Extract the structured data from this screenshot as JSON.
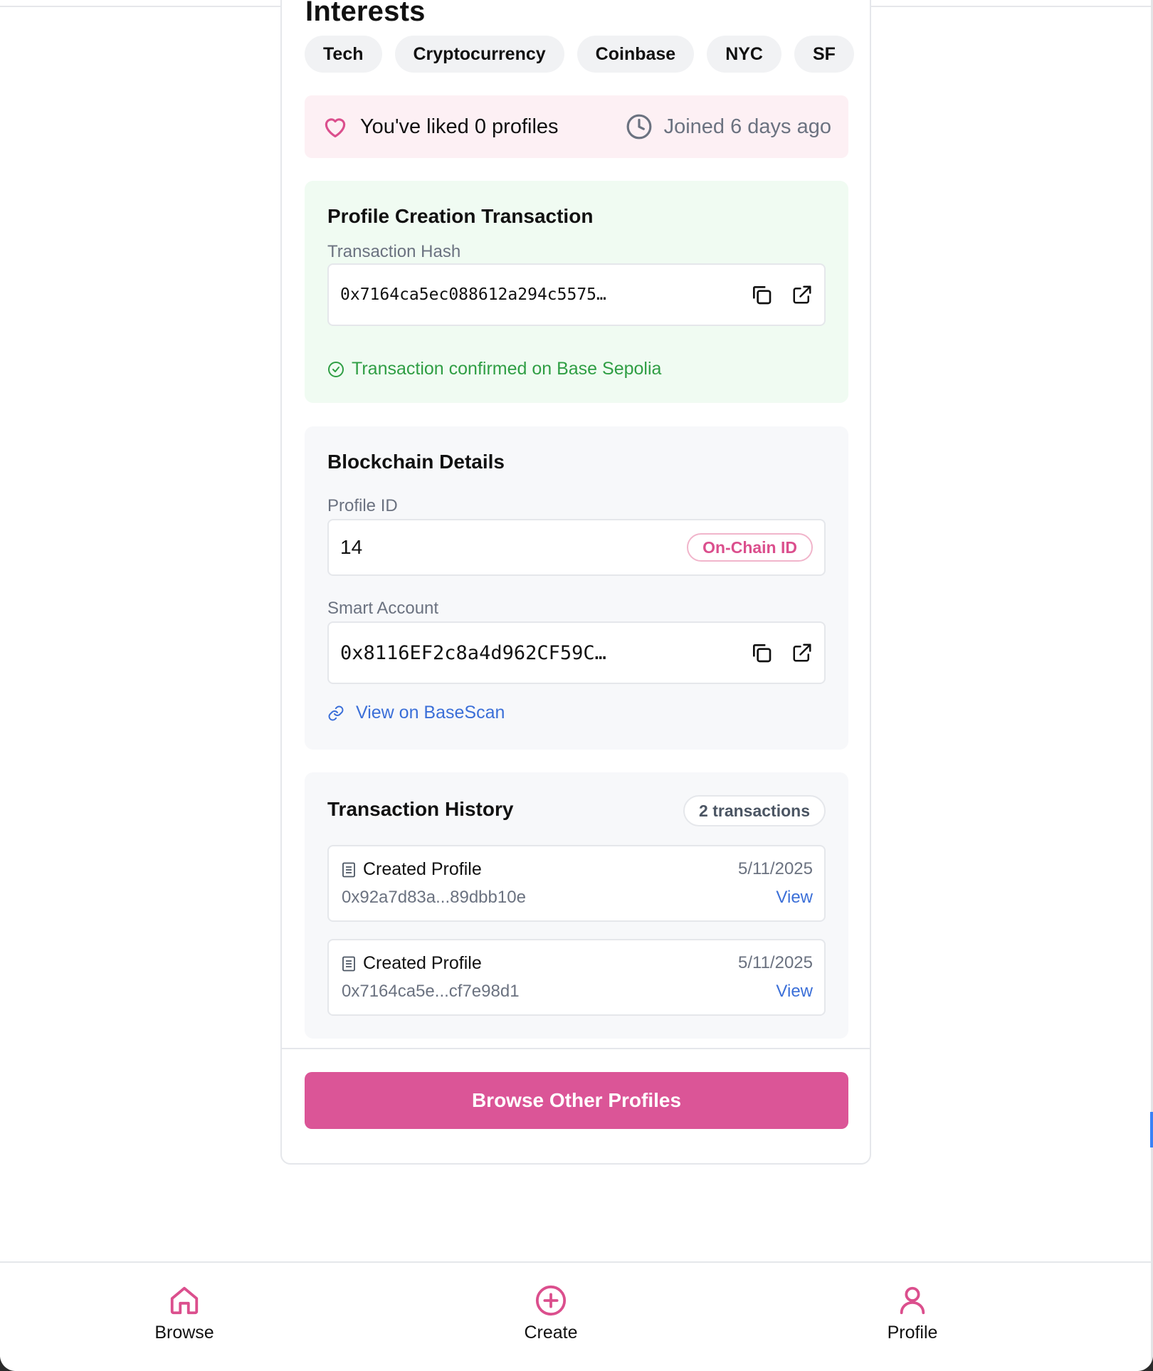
{
  "profile": {
    "interests_heading": "Interests",
    "interests": [
      "Tech",
      "Cryptocurrency",
      "Coinbase",
      "NYC",
      "SF"
    ],
    "liked_text": "You've liked 0 profiles",
    "joined_text": "Joined 6 days ago"
  },
  "creation_tx": {
    "title": "Profile Creation Transaction",
    "hash_label": "Transaction Hash",
    "hash_value": "0x7164ca5ec088612a294c5575…",
    "confirm_text": "Transaction confirmed on Base Sepolia"
  },
  "blockchain": {
    "title": "Blockchain Details",
    "profile_id_label": "Profile ID",
    "profile_id_value": "14",
    "onchain_badge": "On-Chain ID",
    "smart_account_label": "Smart Account",
    "smart_account_value": "0x8116EF2c8a4d962CF59C…",
    "basescan_link": "View on BaseScan"
  },
  "history": {
    "title": "Transaction History",
    "count_badge": "2 transactions",
    "items": [
      {
        "title": "Created Profile",
        "hash": "0x92a7d83a...89dbb10e",
        "date": "5/11/2025",
        "view": "View"
      },
      {
        "title": "Created Profile",
        "hash": "0x7164ca5e...cf7e98d1",
        "date": "5/11/2025",
        "view": "View"
      }
    ]
  },
  "actions": {
    "browse_other": "Browse Other Profiles"
  },
  "nav": {
    "browse": "Browse",
    "create": "Create",
    "profile": "Profile"
  },
  "colors": {
    "accent_pink": "#db5597",
    "success_green": "#2f9e44",
    "link_blue": "#3b6fd8",
    "liked_bg": "#fdf0f4",
    "green_bg": "#f0fbf2",
    "gray_bg": "#f7f8fa"
  },
  "icons": [
    "heart-icon",
    "clock-icon",
    "copy-icon",
    "external-link-icon",
    "check-circle-icon",
    "link-icon",
    "document-icon",
    "home-icon",
    "plus-circle-icon",
    "user-icon"
  ]
}
